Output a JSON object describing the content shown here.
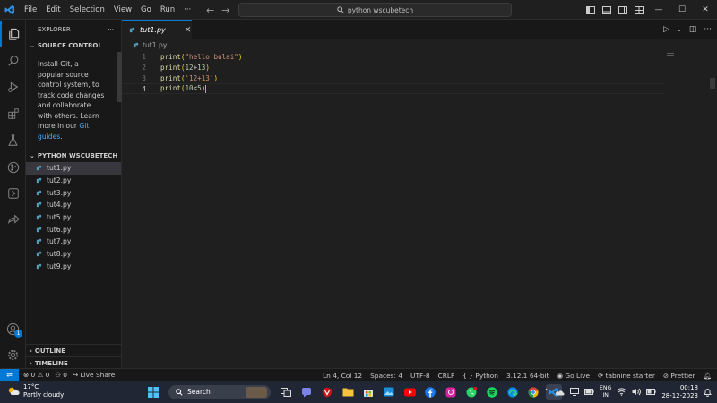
{
  "titlebar": {
    "menu": [
      "File",
      "Edit",
      "Selection",
      "View",
      "Go",
      "Run",
      "···"
    ],
    "command_center": "python wscubetech"
  },
  "sidebar": {
    "header": "EXPLORER",
    "more": "···",
    "source_control": {
      "title": "SOURCE CONTROL",
      "message": "Install Git, a popular source control system, to track code changes and collaborate with others. Learn more in our ",
      "link": "Git guides",
      "suffix": "."
    },
    "folder": {
      "title": "PYTHON WSCUBETECH",
      "files": [
        "tut1.py",
        "tut2.py",
        "tut3.py",
        "tut4.py",
        "tut5.py",
        "tut6.py",
        "tut7.py",
        "tut8.py",
        "tut9.py"
      ]
    },
    "outline": "OUTLINE",
    "timeline": "TIMELINE"
  },
  "activity_badge": "1",
  "tab": {
    "label": "tut1.py",
    "close": "✕"
  },
  "breadcrumb": "tut1.py",
  "editor": {
    "line_numbers": [
      "1",
      "2",
      "3",
      "4"
    ]
  },
  "statusbar": {
    "errors": "0",
    "warnings": "0",
    "ports": "0",
    "live_share": "Live Share",
    "position": "Ln 4, Col 12",
    "spaces": "Spaces: 4",
    "encoding": "UTF-8",
    "eol": "CRLF",
    "language": "Python",
    "interpreter": "3.12.1 64-bit",
    "go_live": "Go Live",
    "tabnine": "tabnine starter",
    "prettier": "Prettier"
  },
  "taskbar": {
    "temperature": "17°C",
    "weather": "Partly cloudy",
    "search": "Search",
    "lang_top": "ENG",
    "lang_bottom": "IN",
    "time": "00:18",
    "date": "28-12-2023"
  },
  "colors": {
    "accent": "#0078d4",
    "editor_bg": "#1f1f1f",
    "sidebar_bg": "#181818",
    "function": "#dcdcaa",
    "string": "#ce9178",
    "number": "#b5cea8",
    "python_icon": "#519aba"
  }
}
